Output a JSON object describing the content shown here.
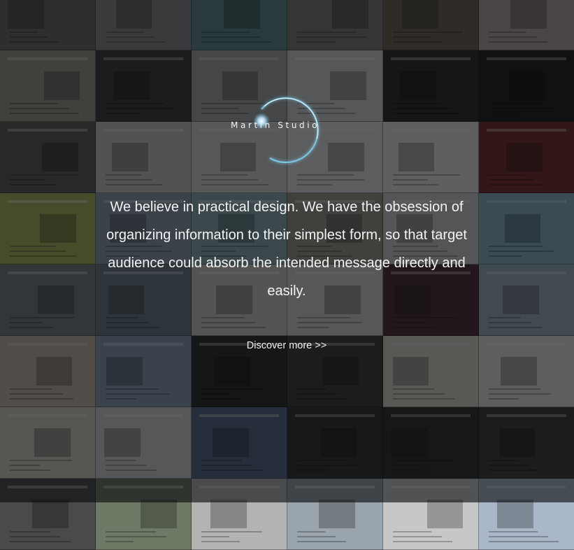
{
  "studio": {
    "name": "Martin Studio"
  },
  "intro": {
    "tagline": "We believe in practical design. We have the obsession of organizing information to their simplest form, so that target audience could absorb the intended message directly and easily."
  },
  "cta": {
    "label": "Discover more >>"
  },
  "colors": {
    "overlay": "#08090c",
    "glow": "#bfe9ff",
    "text": "#f3f3f3"
  },
  "icons": {
    "logo": "glowing-ring-logo"
  },
  "portfolio": {
    "tiles": [
      {
        "color": "#6b6b6b"
      },
      {
        "color": "#8a8a8a"
      },
      {
        "color": "#5f8a8f"
      },
      {
        "color": "#7d7d7d"
      },
      {
        "color": "#6f6456"
      },
      {
        "color": "#b8a6a6"
      },
      {
        "color": "#9a9d8c"
      },
      {
        "color": "#3b3b3b"
      },
      {
        "color": "#a8a8a8"
      },
      {
        "color": "#d6d6d6"
      },
      {
        "color": "#2e2a26"
      },
      {
        "color": "#1e1e1e"
      },
      {
        "color": "#5a5a5a"
      },
      {
        "color": "#c9c9c9"
      },
      {
        "color": "#d8d8d8"
      },
      {
        "color": "#e5e5e5"
      },
      {
        "color": "#e9e9e9"
      },
      {
        "color": "#7a2d2d"
      },
      {
        "color": "#a7b85a"
      },
      {
        "color": "#8f9fb0"
      },
      {
        "color": "#8fb0b8"
      },
      {
        "color": "#9c9c8e"
      },
      {
        "color": "#cfcfcf"
      },
      {
        "color": "#8fb5c7"
      },
      {
        "color": "#7a7f84"
      },
      {
        "color": "#6d7c87"
      },
      {
        "color": "#cfcfc6"
      },
      {
        "color": "#d5d5d5"
      },
      {
        "color": "#4a2f3a"
      },
      {
        "color": "#9fb0c2"
      },
      {
        "color": "#c8b9a8"
      },
      {
        "color": "#8da0b8"
      },
      {
        "color": "#2a2a2a"
      },
      {
        "color": "#3a3a3a"
      },
      {
        "color": "#d9d9cc"
      },
      {
        "color": "#e6e6e6"
      },
      {
        "color": "#d4d2c6"
      },
      {
        "color": "#d6d6d6"
      },
      {
        "color": "#5a6a8a"
      },
      {
        "color": "#303030"
      },
      {
        "color": "#2f2f2f"
      },
      {
        "color": "#3a3a3a"
      },
      {
        "color": "#4a4a4a"
      },
      {
        "color": "#6f7a66"
      },
      {
        "color": "#b3b3b3"
      },
      {
        "color": "#9aa4ad"
      },
      {
        "color": "#c7c7c7"
      },
      {
        "color": "#a9b7c9"
      }
    ]
  }
}
